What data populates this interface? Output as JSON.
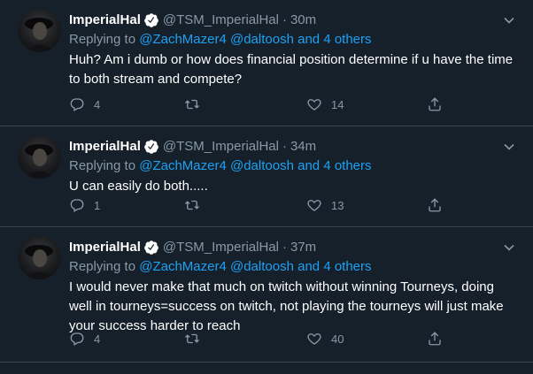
{
  "tweets": [
    {
      "name": "ImperialHal",
      "handle": "@TSM_ImperialHal",
      "separator": "·",
      "time": "30m",
      "replying_prefix": "Replying to",
      "mention1": "@ZachMazer4",
      "mention2": "@daltoosh",
      "mention_and": "and",
      "others": "4 others",
      "text": "Huh? Am i dumb or how does financial position determine if u have the time to both stream and compete?",
      "replies": "4",
      "retweets": "",
      "likes": "14"
    },
    {
      "name": "ImperialHal",
      "handle": "@TSM_ImperialHal",
      "separator": "·",
      "time": "34m",
      "replying_prefix": "Replying to",
      "mention1": "@ZachMazer4",
      "mention2": "@daltoosh",
      "mention_and": "and",
      "others": "4 others",
      "text": "U can easily do both.....",
      "replies": "1",
      "retweets": "",
      "likes": "13"
    },
    {
      "name": "ImperialHal",
      "handle": "@TSM_ImperialHal",
      "separator": "·",
      "time": "37m",
      "replying_prefix": "Replying to",
      "mention1": "@ZachMazer4",
      "mention2": "@daltoosh",
      "mention_and": "and",
      "others": "4 others",
      "text": "I would never make that much on twitch without winning Tourneys, doing well in tourneys=success on twitch, not playing the tourneys will just make your success harder to reach",
      "replies": "4",
      "retweets": "",
      "likes": "40"
    }
  ],
  "colors": {
    "background": "#15202b",
    "divider": "#38444d",
    "secondary_text": "#8899a6",
    "link": "#1da1f2"
  },
  "icons": [
    "verified-badge-icon",
    "chevron-down-icon",
    "reply-icon",
    "retweet-icon",
    "like-icon",
    "share-icon"
  ]
}
